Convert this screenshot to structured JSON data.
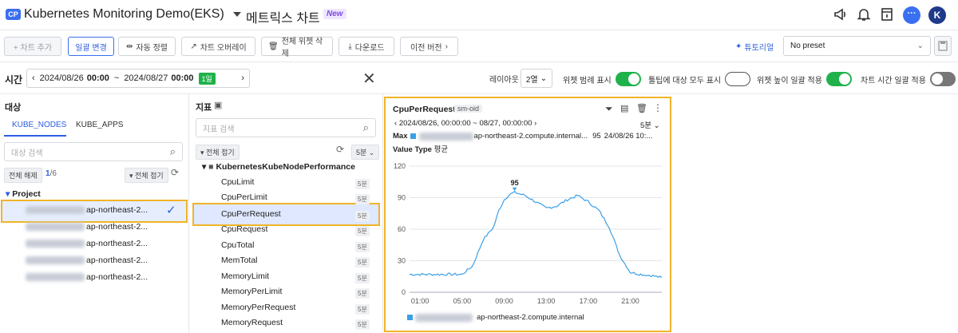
{
  "header": {
    "badge": "CP",
    "app_title": "Kubernetes Monitoring Demo(EKS)",
    "page_title": "메트릭스 차트",
    "new_badge": "New",
    "avatar_letter": "K"
  },
  "toolbar": {
    "add_chart": "+ 차트 추가",
    "bulk_edit": "일괄 변경",
    "auto_sort": "자동 정렬",
    "chart_overlay": "차트 오버레이",
    "delete_all": "전체 위젯 삭제",
    "download": "다운로드",
    "prev_version": "이전 버전",
    "tutorial": "튜토리얼",
    "preset": "No preset"
  },
  "time": {
    "label": "시간",
    "range": "2024/08/26 00:00 ~ 2024/08/27 00:00",
    "range_start": "2024/08/26",
    "start_time": "00:00",
    "sep": "~",
    "range_end": "2024/08/27",
    "end_time": "00:00",
    "period": "1일"
  },
  "options": {
    "layout_label": "레이아웃",
    "layout_value": "2열",
    "legend": "위젯 범례 표시",
    "tooltip_all": "툴팁에 대상 모두 표시",
    "height_all": "위젯 높이 일괄 적용",
    "time_all": "차트 시간 일괄 적용",
    "legend_on": true,
    "tooltip_on": false,
    "height_on": true,
    "time_on": false
  },
  "target": {
    "title": "대상",
    "tabs": [
      "KUBE_NODES",
      "KUBE_APPS"
    ],
    "search_placeholder": "대상 검색",
    "clear_all": "전체 해제",
    "count": "1",
    "count_total": "/6",
    "collapse_all": "전체 접기",
    "group": "Project",
    "nodes": [
      "ap-northeast-2...",
      "ap-northeast-2...",
      "ap-northeast-2...",
      "ap-northeast-2...",
      "ap-northeast-2..."
    ]
  },
  "metrics": {
    "title": "지표",
    "search_placeholder": "지표 검색",
    "collapse_all": "전체 접기",
    "interval": "5분",
    "folder": "KubernetesKubeNodePerformance",
    "items": [
      "CpuLimit",
      "CpuPerLimit",
      "CpuPerRequest",
      "CpuRequest",
      "CpuTotal",
      "MemTotal",
      "MemoryLimit",
      "MemoryPerLimit",
      "MemoryPerRequest",
      "MemoryRequest"
    ],
    "item_interval": "5분"
  },
  "chart_widget": {
    "title": "CpuPerRequest",
    "tag": "sm-oid",
    "range": "2024/08/26, 00:00:00 ~ 08/27, 00:00:00",
    "interval": "5분",
    "max_label": "Max",
    "max_host": "ap-northeast-2.compute.internal...",
    "max_value": "95",
    "max_time": "24/08/26 10:...",
    "value_type_label": "Value Type",
    "value_type": "평균",
    "peak_label": "95",
    "legend_host": "ap-northeast-2.compute.internal",
    "series_color": "#3b9fe6"
  },
  "chart_data": {
    "type": "line",
    "ylim": [
      0,
      120
    ],
    "yticks": [
      "0",
      "30",
      "60",
      "90",
      "120"
    ],
    "xticks": [
      "01:00",
      "05:00",
      "09:00",
      "13:00",
      "17:00",
      "21:00"
    ],
    "series": [
      {
        "x": [
          "00:00",
          "01:00",
          "02:00",
          "03:00",
          "04:00",
          "05:00",
          "06:00",
          "07:00",
          "08:00",
          "08:30",
          "09:00",
          "09:30",
          "10:00",
          "11:00",
          "12:00",
          "13:00",
          "14:00",
          "15:00",
          "16:00",
          "17:00",
          "18:00",
          "19:00",
          "20:00",
          "21:00",
          "22:00",
          "23:00",
          "23:59"
        ],
        "values": [
          17,
          17,
          17,
          17,
          17,
          17,
          25,
          50,
          62,
          78,
          88,
          93,
          95,
          92,
          86,
          80,
          82,
          88,
          92,
          86,
          78,
          62,
          35,
          19,
          17,
          16,
          14
        ]
      }
    ]
  }
}
